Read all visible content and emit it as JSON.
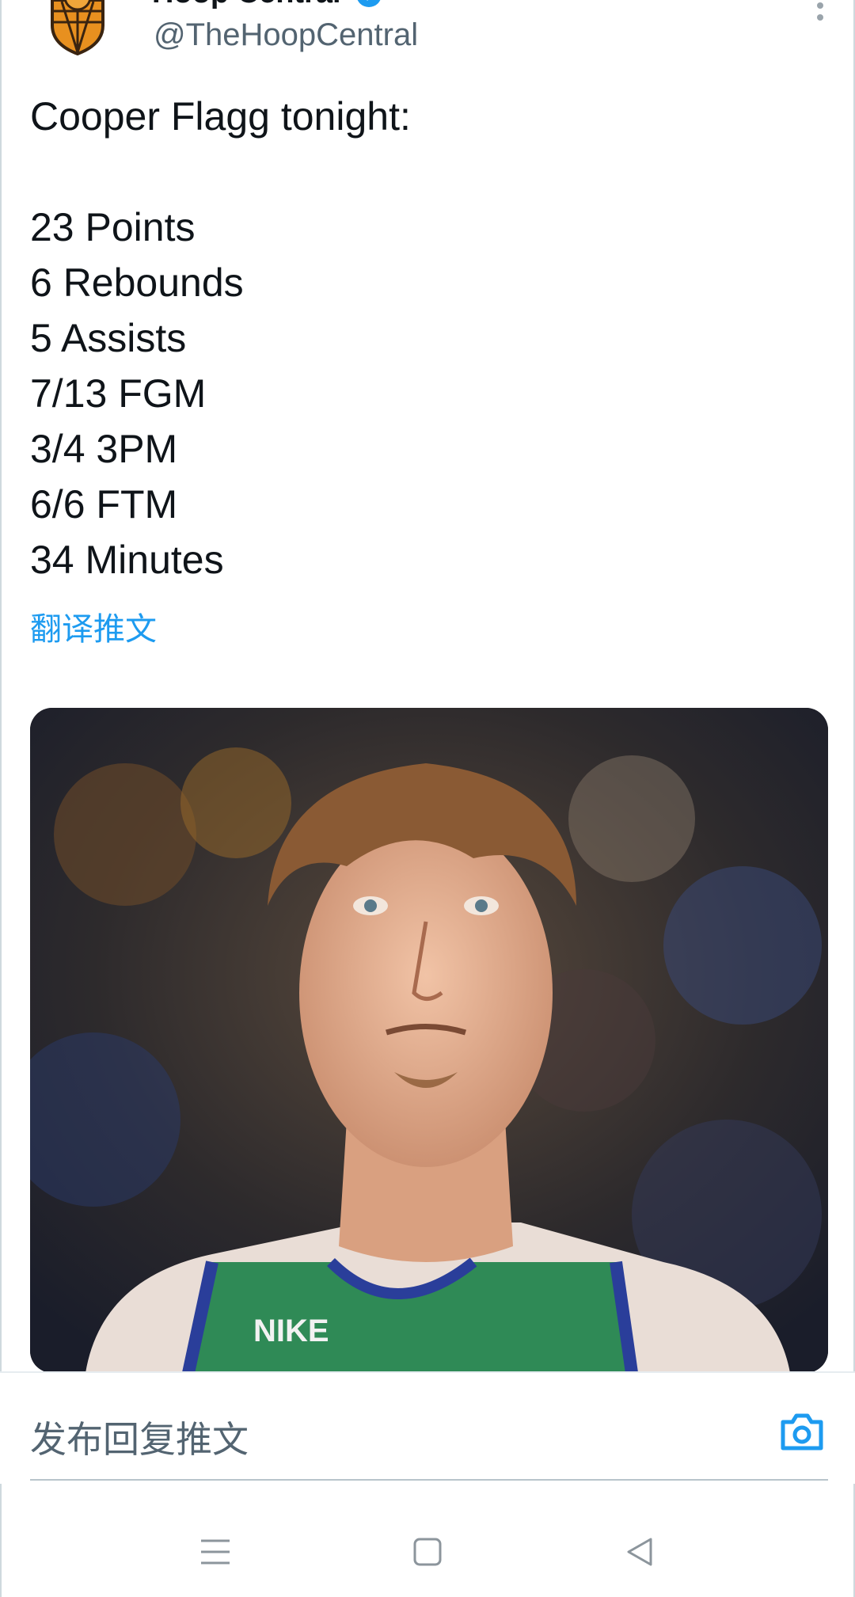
{
  "header": {
    "display_name": "Hoop Central",
    "handle": "@TheHoopCentral",
    "avatar_icon": "basketball-shield-logo-icon",
    "more_icon": "vertical-dots-icon"
  },
  "tweet": {
    "lines": [
      "Cooper Flagg tonight:",
      "",
      "23 Points",
      "6 Rebounds",
      "5 Assists",
      "7/13 FGM",
      "3/4 3PM",
      "6/6 FTM",
      "34 Minutes"
    ],
    "translate_label": "翻译推文"
  },
  "media": {
    "jersey_brand": "NIKE",
    "jersey_color": "#2f8a56",
    "trim_color": "#2a3e9a"
  },
  "reply_bar": {
    "placeholder": "发布回复推文",
    "camera_icon": "camera-icon"
  },
  "colors": {
    "accent": "#1d9bf0",
    "text": "#0f1419",
    "muted": "#536471"
  },
  "system_nav": {
    "menu_icon": "menu-lines-icon",
    "home_icon": "home-square-icon",
    "back_icon": "back-triangle-icon"
  }
}
